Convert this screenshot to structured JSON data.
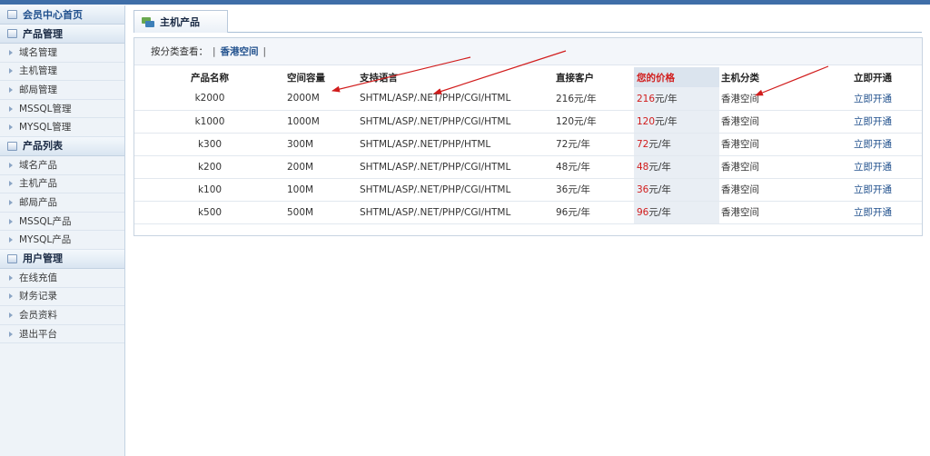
{
  "sidebar": {
    "home": "会员中心首页",
    "sections": [
      {
        "title": "产品管理",
        "items": [
          "域名管理",
          "主机管理",
          "邮局管理",
          "MSSQL管理",
          "MYSQL管理"
        ]
      },
      {
        "title": "产品列表",
        "items": [
          "域名产品",
          "主机产品",
          "邮局产品",
          "MSSQL产品",
          "MYSQL产品"
        ]
      },
      {
        "title": "用户管理",
        "items": [
          "在线充值",
          "财务记录",
          "会员资料",
          "退出平台"
        ]
      }
    ]
  },
  "tab": {
    "label": "主机产品"
  },
  "filter": {
    "label": "按分类查看：",
    "sep1": "|",
    "category": "香港空间",
    "sep2": "|"
  },
  "table": {
    "headers": [
      "产品名称",
      "空间容量",
      "支持语言",
      "直接客户",
      "您的价格",
      "主机分类",
      "立即开通"
    ],
    "rows": [
      {
        "name": "k2000",
        "capacity": "2000M",
        "languages": "SHTML/ASP/.NET/PHP/CGI/HTML",
        "direct_price": "216元/年",
        "your_price": "216",
        "your_price_unit": "元/年",
        "category": "香港空间",
        "action": "立即开通"
      },
      {
        "name": "k1000",
        "capacity": "1000M",
        "languages": "SHTML/ASP/.NET/PHP/CGI/HTML",
        "direct_price": "120元/年",
        "your_price": "120",
        "your_price_unit": "元/年",
        "category": "香港空间",
        "action": "立即开通"
      },
      {
        "name": "k300",
        "capacity": "300M",
        "languages": "SHTML/ASP/.NET/PHP/HTML",
        "direct_price": "72元/年",
        "your_price": "72",
        "your_price_unit": "元/年",
        "category": "香港空间",
        "action": "立即开通"
      },
      {
        "name": "k200",
        "capacity": "200M",
        "languages": "SHTML/ASP/.NET/PHP/CGI/HTML",
        "direct_price": "48元/年",
        "your_price": "48",
        "your_price_unit": "元/年",
        "category": "香港空间",
        "action": "立即开通"
      },
      {
        "name": "k100",
        "capacity": "100M",
        "languages": "SHTML/ASP/.NET/PHP/CGI/HTML",
        "direct_price": "36元/年",
        "your_price": "36",
        "your_price_unit": "元/年",
        "category": "香港空间",
        "action": "立即开通"
      },
      {
        "name": "k500",
        "capacity": "500M",
        "languages": "SHTML/ASP/.NET/PHP/CGI/HTML",
        "direct_price": "96元/年",
        "your_price": "96",
        "your_price_unit": "元/年",
        "category": "香港空间",
        "action": "立即开通"
      }
    ]
  },
  "colors": {
    "accent": "#3f6ea8",
    "price_red": "#d11c1c",
    "annotation_arrow": "#d11c1c"
  }
}
